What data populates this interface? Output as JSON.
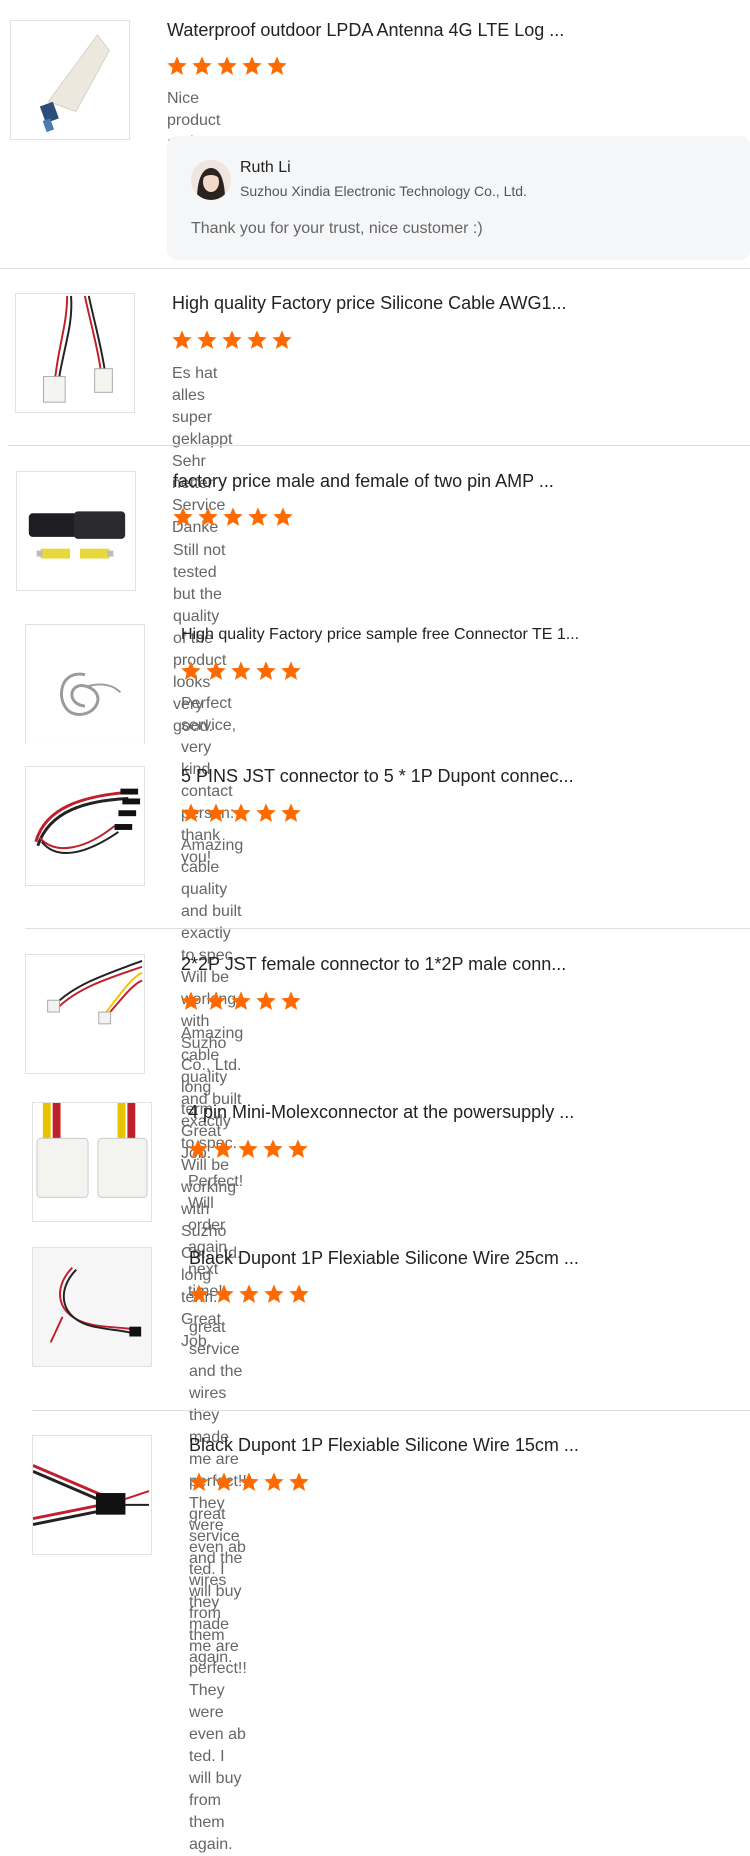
{
  "colors": {
    "star": "#ff6a00",
    "divider": "#dedede",
    "reply_bg": "#f5f6f8"
  },
  "reviews": [
    {
      "title": "Waterproof outdoor LPDA Antenna 4G LTE Log ...",
      "rating": 5,
      "comment": "Nice product and easy transaction",
      "image": "antenna-image",
      "reply": {
        "name": "Ruth Li",
        "company": "Suzhou Xindia Electronic Technology Co., Ltd.",
        "text": "Thank you for your trust, nice customer :)"
      }
    },
    {
      "title": "High quality Factory price Silicone Cable AWG1...",
      "rating": 5,
      "comment": "Es hat alles super geklappt\nSehr netter Service\nDanke",
      "image": "silicone-cable-image"
    },
    {
      "title": "factory price male and female of two pin AMP ...",
      "rating": 5,
      "comment": "Still not tested but the quality of the product looks very good.",
      "image": "amp-connector-image"
    },
    {
      "title": "High quality Factory price sample free Connector TE 1...",
      "rating": 5,
      "comment": "Perfect service, very kind contact person: thank you!",
      "image": "grey-cable-image"
    },
    {
      "title": "5 PINS JST connector to 5 * 1P Dupont connec...",
      "rating": 5,
      "comment": "Amazing cable quality and built exactly to spec.  Will be working with Suzho\nCo., Ltd. long term.  Great Job.",
      "image": "dupont-bundle-image"
    },
    {
      "title": "2*2P JST female connector to 1*2P male conn...",
      "rating": 5,
      "comment": "Amazing cable quality and built exactly to spec.  Will be working with Suzho\nCo., Ltd. long term.  Great Job.",
      "image": "jst-cable-image"
    },
    {
      "title": "4 pin Mini-Molexconnector at the powersupply ...",
      "rating": 5,
      "comment": "Perfect! Will order again next time!",
      "image": "molex-connector-image"
    },
    {
      "title": "Black Dupont 1P Flexiable Silicone Wire 25cm ...",
      "rating": 5,
      "comment": "great service and the wires they made me are perfect!! They were even ab\nted. I will buy from them again.",
      "image": "dupont-wire-25-image"
    },
    {
      "title": "Black Dupont 1P Flexiable Silicone Wire 15cm ...",
      "rating": 5,
      "comment": "great service and the wires they made me are perfect!! They were even ab\nted. I will buy from them again.",
      "image": "dupont-wire-15-image"
    }
  ]
}
